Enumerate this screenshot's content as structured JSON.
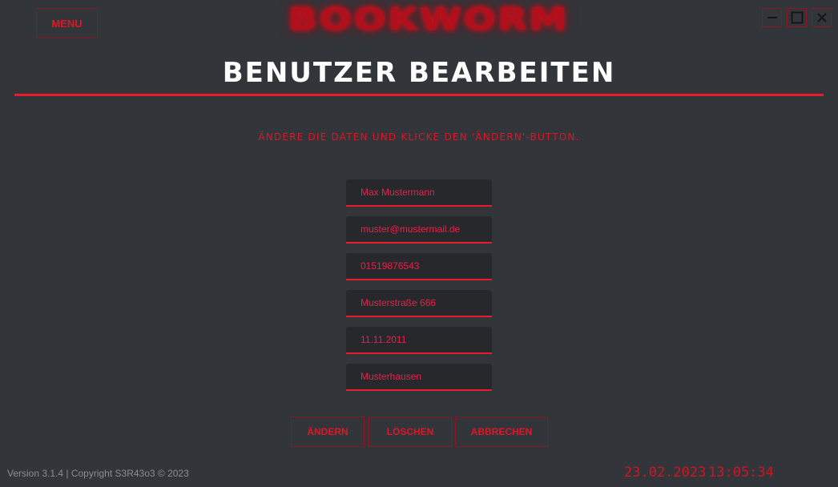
{
  "header": {
    "menu_label": "MENU",
    "brand": "BOOKWORM",
    "page_title": "BENUTZER BEARBEITEN",
    "instruction": "Ändere die Daten und klicke den 'Ändern'-Button."
  },
  "window_controls": [
    {
      "icon": "minimize-icon"
    },
    {
      "icon": "maximize-icon"
    },
    {
      "icon": "close-icon"
    }
  ],
  "form": {
    "name": "Max Mustermann",
    "email": "muster@mustermail.de",
    "phone": "01519876543",
    "street": "Musterstraße 666",
    "birthdate": "11.11.2011",
    "city": "Musterhausen"
  },
  "actions": {
    "change_label": "ÄNDERN",
    "delete_label": "LÖSCHEN",
    "cancel_label": "ABBRECHEN"
  },
  "footer": {
    "version": "Version 3.1.4 | Copyright S3R43o3 © 2023",
    "date": "23.02.2023",
    "time": "13:05:34"
  },
  "colors": {
    "background": "#32353a",
    "accent": "#e81c2a",
    "field_background": "#26282c",
    "title": "#ffffff"
  }
}
